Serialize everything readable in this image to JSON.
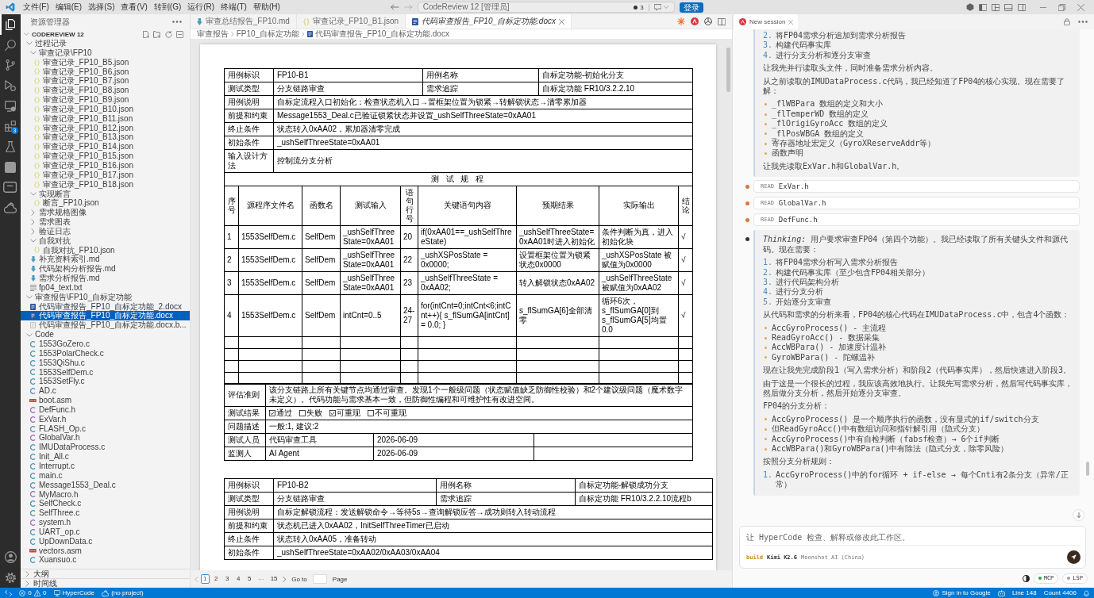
{
  "title_bar": {
    "menu": [
      "文件(F)",
      "编辑(E)",
      "选择(S)",
      "查看(V)",
      "转到(G)",
      "运行(R)",
      "终端(T)",
      "帮助(H)"
    ],
    "command_center": "CodeReview 12 [管理员]",
    "count": "3",
    "sign_in": "登录"
  },
  "activity_bar": {
    "items": [
      {
        "selected": true
      },
      {
        "selected": false
      },
      {
        "selected": false
      },
      {
        "selected": false
      },
      {
        "selected": false
      },
      {
        "selected": false,
        "badge": "3"
      },
      {
        "selected": false
      },
      {
        "selected": false
      },
      {
        "selected": false
      },
      {
        "selected": false
      }
    ]
  },
  "sidebar": {
    "title": "资源管理器",
    "workspace": {
      "label": "CODEREVIEW 12",
      "expanded": true
    },
    "tree": [
      {
        "label": "过程记录",
        "kind": "folder",
        "expanded": true,
        "selected": false,
        "children": [
          {
            "label": "审查记录\\FP10",
            "kind": "folder",
            "expanded": true,
            "selected": false,
            "children": [
              {
                "label": "审查记录_FP10_B5.json",
                "kind": "json",
                "selected": false
              },
              {
                "label": "审查记录_FP10_B6.json",
                "kind": "json",
                "selected": false
              },
              {
                "label": "审查记录_FP10_B7.json",
                "kind": "json",
                "selected": false
              },
              {
                "label": "审查记录_FP10_B8.json",
                "kind": "json",
                "selected": false
              },
              {
                "label": "审查记录_FP10_B9.json",
                "kind": "json",
                "selected": false
              },
              {
                "label": "审查记录_FP10_B10.json",
                "kind": "json",
                "selected": false
              },
              {
                "label": "审查记录_FP10_B11.json",
                "kind": "json",
                "selected": false
              },
              {
                "label": "审查记录_FP10_B12.json",
                "kind": "json",
                "selected": false
              },
              {
                "label": "审查记录_FP10_B13.json",
                "kind": "json",
                "selected": false
              },
              {
                "label": "审查记录_FP10_B14.json",
                "kind": "json",
                "selected": false
              },
              {
                "label": "审查记录_FP10_B15.json",
                "kind": "json",
                "selected": false
              },
              {
                "label": "审查记录_FP10_B16.json",
                "kind": "json",
                "selected": false
              },
              {
                "label": "审查记录_FP10_B17.json",
                "kind": "json",
                "selected": false
              },
              {
                "label": "审查记录_FP10_B18.json",
                "kind": "json",
                "selected": false
              }
            ]
          },
          {
            "label": "实现断言",
            "kind": "folder",
            "expanded": true,
            "selected": false,
            "children": [
              {
                "label": "断言_FP10.json",
                "kind": "json",
                "selected": false
              }
            ]
          },
          {
            "label": "需求规格图像",
            "kind": "folder",
            "expanded": false,
            "selected": false
          },
          {
            "label": "需求图表",
            "kind": "folder",
            "expanded": false,
            "selected": false
          },
          {
            "label": "验证日志",
            "kind": "folder",
            "expanded": false,
            "selected": false
          },
          {
            "label": "自我对抗",
            "kind": "folder",
            "expanded": true,
            "selected": false,
            "children": [
              {
                "label": "自我对抗_FP10.json",
                "kind": "json",
                "selected": false
              }
            ]
          },
          {
            "label": "补充资料索引.md",
            "kind": "markdown",
            "selected": false
          },
          {
            "label": "代码架构分析报告.md",
            "kind": "markdown",
            "selected": false
          },
          {
            "label": "需求分析报告.md",
            "kind": "markdown",
            "selected": false
          },
          {
            "label": "fp04_text.txt",
            "kind": "text",
            "selected": false
          }
        ]
      },
      {
        "label": "审查报告\\FP10_自标定功能",
        "kind": "folder",
        "expanded": true,
        "selected": false,
        "children": [
          {
            "label": "代码审查报告_FP10_自标定功能_2.docx",
            "kind": "word",
            "selected": false
          },
          {
            "label": "代码审查报告_FP10_自标定功能.docx",
            "kind": "word",
            "selected": true
          },
          {
            "label": "代码审查报告_FP10_自标定功能.docx.b...",
            "kind": "backup",
            "selected": false
          }
        ]
      },
      {
        "label": "Code",
        "kind": "folder",
        "expanded": true,
        "selected": false,
        "children": [
          {
            "label": "1553GoZero.c",
            "kind": "c",
            "selected": false
          },
          {
            "label": "1553PolarCheck.c",
            "kind": "c",
            "selected": false
          },
          {
            "label": "1553QiShu.c",
            "kind": "c",
            "selected": false
          },
          {
            "label": "1553SelfDem.c",
            "kind": "c",
            "selected": false
          },
          {
            "label": "1553SetFly.c",
            "kind": "c",
            "selected": false
          },
          {
            "label": "AD.c",
            "kind": "c",
            "selected": false
          },
          {
            "label": "boot.asm",
            "kind": "asm",
            "selected": false
          },
          {
            "label": "DefFunc.h",
            "kind": "header",
            "selected": false
          },
          {
            "label": "ExVar.h",
            "kind": "header",
            "selected": false
          },
          {
            "label": "FLASH_Op.c",
            "kind": "c",
            "selected": false
          },
          {
            "label": "GlobalVar.h",
            "kind": "header",
            "selected": false
          },
          {
            "label": "IMUDataProcess.c",
            "kind": "c",
            "selected": false
          },
          {
            "label": "Init_All.c",
            "kind": "c",
            "selected": false
          },
          {
            "label": "Interrupt.c",
            "kind": "c",
            "selected": false
          },
          {
            "label": "main.c",
            "kind": "c",
            "selected": false
          },
          {
            "label": "Message1553_Deal.c",
            "kind": "c",
            "selected": false
          },
          {
            "label": "MyMacro.h",
            "kind": "header",
            "selected": false
          },
          {
            "label": "SelfCheck.c",
            "kind": "c",
            "selected": false
          },
          {
            "label": "SelfThree.c",
            "kind": "c",
            "selected": false
          },
          {
            "label": "system.h",
            "kind": "header",
            "selected": false
          },
          {
            "label": "UART_op.c",
            "kind": "c",
            "selected": false
          },
          {
            "label": "UpDownData.c",
            "kind": "c",
            "selected": false
          },
          {
            "label": "vectors.asm",
            "kind": "asm",
            "selected": false
          },
          {
            "label": "Xuansuo.c",
            "kind": "c",
            "selected": false
          }
        ]
      }
    ],
    "sections": [
      {
        "label": "大纲",
        "expanded": false
      },
      {
        "label": "时间线",
        "expanded": false
      }
    ]
  },
  "editor": {
    "tabs": [
      {
        "label": "审查总结报告_FP10.md",
        "kind": "markdown",
        "selected": false,
        "preview": false
      },
      {
        "label": "审查记录_FP10_B1.json",
        "kind": "json",
        "selected": false,
        "preview": false
      },
      {
        "label": "代码审查报告_FP10_自标定功能.docx",
        "kind": "word",
        "selected": true,
        "preview": true
      }
    ],
    "breadcrumb": [
      "审查报告",
      "FP10_自标定功能",
      "代码审查报告_FP10_自标定功能.docx"
    ],
    "document": {
      "cases": [
        {
          "info_rows": [
            [
              "用例标识",
              "FP10-B1",
              "用例名称",
              "自标定功能-初始化分支"
            ],
            [
              "测试类型",
              "分支链路审查",
              "需求追踪",
              "自标定功能 FR10/3.2.2.10"
            ],
            [
              "用例说明",
              "自标定流程入口初始化：检查状态机入口→置框架位置为锁紧→转解锁状态→清零累加器"
            ],
            [
              "前提和约束",
              "Message1553_Deal.c已验证锁紧状态并设置_ushSelfThreeState=0xAA01"
            ],
            [
              "终止条件",
              "状态转入0xAA02，累加器清零完成"
            ],
            [
              "初始条件",
              "_ushSelfThreeState=0xAA01"
            ],
            [
              "输入设计方法",
              "控制流分支分析"
            ]
          ],
          "steps_title": "测 试 规 程",
          "step_columns": [
            "序号",
            "源程序文件名",
            "函数名",
            "测试输入",
            "语句行号",
            "关键语句内容",
            "预期结果",
            "实际输出",
            "结论"
          ],
          "steps": [
            [
              "1",
              "1553SelfDem.c",
              "SelfDem",
              "_ushSelfThreeState=0xAA01",
              "20",
              "if(0xAA01==_ushSelfThreeState)",
              "_ushSelfThreeState=0xAA01时进入初始化",
              "条件判断为真，进入初始化块",
              "√"
            ],
            [
              "2",
              "1553SelfDem.c",
              "SelfDem",
              "_ushSelfThreeState=0xAA01",
              "22",
              "_ushXSPosState = 0x0000;",
              "设置框架位置为锁紧状态0x0000",
              "_ushXSPosState 被赋值为0x0000",
              "√"
            ],
            [
              "3",
              "1553SelfDem.c",
              "SelfDem",
              "_ushSelfThreeState=0xAA01",
              "23",
              "_ushSelfThreeState = 0xAA02;",
              "转入解锁状态0xAA02",
              "_ushSelfThreeState被赋值为0xAA02",
              "√"
            ],
            [
              "4",
              "1553SelfDem.c",
              "SelfDem",
              "intCnt=0..5",
              "24-27",
              "for(intCnt=0;intCnt<6;intCnt++){ s_flSumGA[intCnt] = 0.0; }",
              "s_flSumGA[6]全部清零",
              "循环6次，s_flSumGA[0]到s_flSumGA[5]均置0.0",
              "√"
            ]
          ],
          "footer_rows": [
            {
              "kind": "text",
              "label": "评估准则",
              "value": "该分支链路上所有关键节点均通过审查。发现1个一般级问题（状态赋值缺乏防御性校验）和2个建议级问题（魔术数字未定义）。代码功能与需求基本一致，但防御性编程和可维护性有改进空间。"
            },
            {
              "kind": "checks",
              "label": "测试结果",
              "options": [
                {
                  "label": "通过",
                  "checked": true
                },
                {
                  "label": "失败",
                  "checked": false
                },
                {
                  "label": "可重现",
                  "checked": true
                },
                {
                  "label": "不可重现",
                  "checked": false
                }
              ]
            },
            {
              "kind": "text",
              "label": "问题描述",
              "value": "一般:1, 建议:2"
            },
            {
              "kind": "signature",
              "label": "测试人员",
              "name": "代码审查工具",
              "date": "2026-06-09"
            },
            {
              "kind": "signature",
              "label": "监测人",
              "name": "AI Agent",
              "date": "2026-06-09"
            }
          ]
        },
        {
          "info_rows": [
            [
              "用例标识",
              "FP10-B2",
              "用例名称",
              "自标定功能-解锁成功分支"
            ],
            [
              "测试类型",
              "分支链路审查",
              "需求追踪",
              "自标定功能 FR10/3.2.2.10流程b"
            ],
            [
              "用例说明",
              "自标定解锁流程：发送解锁命令→等待5s→查询解锁应答→成功则转入转动流程"
            ],
            [
              "前提和约束",
              "状态机已进入0xAA02，InitSelfThreeTimer已启动"
            ],
            [
              "终止条件",
              "状态转入0xAA05，准备转动"
            ],
            [
              "初始条件",
              "_ushSelfThreeState=0xAA02/0xAA03/0xAA04"
            ]
          ]
        }
      ]
    },
    "pagination": {
      "pages": [
        {
          "kind": "page",
          "label": "1",
          "selected": true
        },
        {
          "kind": "page",
          "label": "2",
          "selected": false
        },
        {
          "kind": "page",
          "label": "3",
          "selected": false
        },
        {
          "kind": "page",
          "label": "4",
          "selected": false
        },
        {
          "kind": "page",
          "label": "5",
          "selected": false
        },
        {
          "kind": "ellipsis",
          "label": "···"
        },
        {
          "kind": "page",
          "label": "15",
          "selected": false
        }
      ],
      "goto": "Go to",
      "page": "Page"
    }
  },
  "chat": {
    "tab": {
      "label": "New session",
      "selected": true
    },
    "messages": [
      {
        "kind": "card",
        "blocks": [
          {
            "kind": "ordered",
            "items": [
              {
                "number": "2.",
                "text": "将FP04需求分析追加到需求分析报告"
              },
              {
                "number": "3.",
                "text": "构建代码事实库"
              },
              {
                "number": "4.",
                "text": "进行分支分析和逐分支审查"
              }
            ]
          },
          {
            "kind": "paragraph",
            "text": "让我先并行读取头文件，同时准备需求分析内容。"
          },
          {
            "kind": "paragraph",
            "text": "从之前读取的IMUDataProcess.c代码，我已经知道了FP04的核心实现。现在需要了解："
          },
          {
            "kind": "bullets",
            "items": [
              "_flWBPara 数组的定义和大小",
              "_flTemperWD 数组的定义",
              "_flOrigiGyroAcc 数组的定义",
              "_flPosWBGA 数组的定义",
              "寄存器地址宏定义（GyroXReserveAddr等）",
              "函数声明"
            ]
          },
          {
            "kind": "paragraph",
            "text": "让我先读取ExVar.h和GlobalVar.h。"
          }
        ]
      },
      {
        "kind": "tool",
        "color": "#d9773a",
        "action": "READ",
        "target": "ExVar.h"
      },
      {
        "kind": "tool",
        "color": "#d9773a",
        "action": "READ",
        "target": "GlobalVar.h"
      },
      {
        "kind": "tool",
        "color": "#d9773a",
        "action": "READ",
        "target": "DefFunc.h"
      },
      {
        "kind": "card",
        "color": "#333333",
        "blocks": [
          {
            "kind": "paragraph",
            "text": "*Thinking:* 用户要求审查FP04（第四个功能）。我已经读取了所有关键头文件和源代码。现在需要："
          },
          {
            "kind": "ordered",
            "items": [
              {
                "number": "1.",
                "text": "将FP04需求分析写入需求分析报告"
              },
              {
                "number": "2.",
                "text": "构建代码事实库（至少包含FP04相关部分）"
              },
              {
                "number": "3.",
                "text": "进行代码架构分析"
              },
              {
                "number": "4.",
                "text": "进行分支分析"
              },
              {
                "number": "5.",
                "text": "开始逐分支审查"
              }
            ]
          },
          {
            "kind": "paragraph",
            "text": "从代码和需求的分析来看，FP04的核心代码在IMUDataProcess.c中，包含4个函数："
          },
          {
            "kind": "bullets",
            "items": [
              "AccGyroProcess() - 主流程",
              "ReadGyroAcc() - 数据采集",
              "AccWBPara() - 加速度计温补",
              "GyroWBPara() - 陀螺温补"
            ]
          },
          {
            "kind": "paragraph",
            "text": "现在让我先完成阶段1（写入需求分析）和阶段2（代码事实库），然后快速进入阶段3。"
          },
          {
            "kind": "paragraph",
            "text": "由于这是一个很长的过程，我应该高效地执行。让我先写需求分析，然后写代码事实库，然后做分支分析，然后开始逐分支审查。"
          },
          {
            "kind": "paragraph",
            "text": "FP04的分支分析："
          },
          {
            "kind": "bullets",
            "items": [
              "AccGyroProcess() 是一个顺序执行的函数，没有显式的if/switch分支",
              "但ReadGyroAcc()中有数组访问和指针解引用（隐式分支）",
              "AccGyroProcess()中有自检判断（fabsf检查）→ 6个if判断",
              "AccWBPara()和GyroWBPara()中有除法（隐式分支，除零风险）"
            ]
          },
          {
            "kind": "paragraph",
            "text": "按照分支分析规则："
          },
          {
            "kind": "ordered",
            "items": [
              {
                "number": "1.",
                "text": "AccGyroProcess()中的for循环 + if-else → 每个Cnti有2条分支（异常/正常）"
              }
            ]
          }
        ]
      }
    ],
    "input": {
      "placeholder": "让 HyperCode 检查、解释或修改此工作区。",
      "mode": "build",
      "model": "Kimi K2.6",
      "provider": "Moonshot AI (China)"
    },
    "status": [
      {
        "label": "MCP",
        "color": "#2ea043"
      },
      {
        "label": "LSP",
        "color": "#9e9e9e"
      }
    ]
  },
  "status_bar": {
    "errors": "0",
    "warnings": "0",
    "tool": "HyperCode",
    "project": "(no project)",
    "account": "Sign in to Google",
    "line": "Line 148",
    "count": "Count 4406"
  }
}
